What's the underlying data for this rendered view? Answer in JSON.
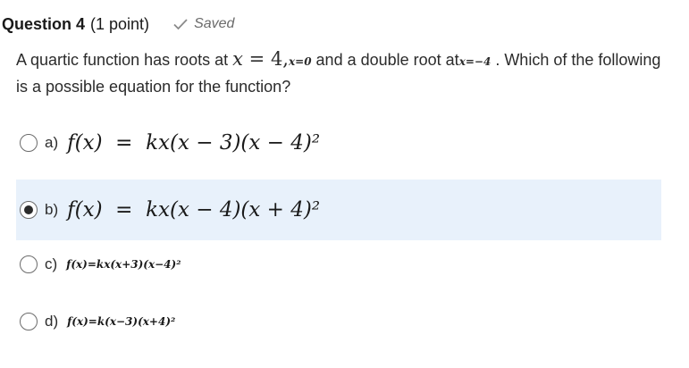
{
  "header": {
    "title": "Question 4",
    "points": "(1 point)",
    "saved_label": "Saved"
  },
  "question": {
    "text_before": "A quartic function has roots at ",
    "var_x": "x",
    "eq_sign": " = ",
    "value": "4,",
    "small_root": "x=0",
    "text_mid": " and a double root at",
    "small_double": "x=−4",
    "text_after": " . Which of the following is a possible equation for the function?"
  },
  "options": [
    {
      "letter": "a)",
      "equation": "f(x)  =  kx(x − 3)(x − 4)²",
      "selected": false
    },
    {
      "letter": "b)",
      "equation": "f(x)  =  kx(x − 4)(x + 4)²",
      "selected": true
    },
    {
      "letter": "c)",
      "equation": "f(x)=kx(x+3)(x−4)²",
      "selected": false
    },
    {
      "letter": "d)",
      "equation": "f(x)=k(x−3)(x+4)²",
      "selected": false
    }
  ]
}
